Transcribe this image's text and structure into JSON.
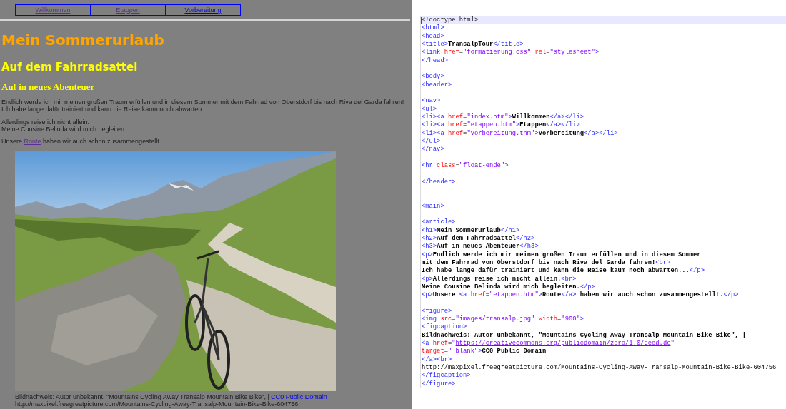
{
  "browser_page": {
    "nav": [
      {
        "label": "Willkommen",
        "visited": true
      },
      {
        "label": "Etappen",
        "visited": true
      },
      {
        "label": "Vorbereitung",
        "visited": false
      }
    ],
    "h1": "Mein Sommerurlaub",
    "h2": "Auf dem Fahrradsattel",
    "h3": "Auf in neues Abenteuer",
    "paragraphs": [
      {
        "kind": "text",
        "lines": [
          "Endlich werde ich mir meinen großen Traum erfüllen und in diesem Sommer mit dem Fahrrad von Oberstdorf bis nach Riva del Garda fahren!",
          "Ich habe lange dafür trainiert und kann die Reise kaum noch abwarten..."
        ]
      },
      {
        "kind": "text",
        "lines": [
          "Allerdings reise ich nicht allein.",
          "Meine Cousine Belinda wird mich begleiten."
        ]
      },
      {
        "kind": "link",
        "before": "Unsere ",
        "link": {
          "label": "Route",
          "visited": true
        },
        "after": " haben wir auch schon zusammengestellt."
      }
    ],
    "figure": {
      "caption_text": "Bildnachweis: Autor unbekannt, \"Mountains Cycling Away Transalp Mountain Bike Bike\", | ",
      "caption_link": {
        "label": "CC0 Public Domain",
        "visited": false
      },
      "caption_source": "http://maxpixel.freegreatpicture.com/Mountains-Cycling-Away-Transalp-Mountain-Bike-Bike-604756"
    }
  },
  "editor": {
    "lines": [
      {
        "current": true,
        "tokens": [
          {
            "kind": "doctype",
            "text": "<!doctype html>"
          }
        ]
      },
      {
        "current": false,
        "tokens": [
          {
            "kind": "tag",
            "text": "<html>"
          }
        ]
      },
      {
        "current": false,
        "tokens": [
          {
            "kind": "tag",
            "text": "<head>"
          }
        ]
      },
      {
        "current": false,
        "tokens": [
          {
            "kind": "tag",
            "text": "<title>"
          },
          {
            "kind": "text",
            "text": "TransalpTour"
          },
          {
            "kind": "tag",
            "text": "</title>"
          }
        ]
      },
      {
        "current": false,
        "tokens": [
          {
            "kind": "tag",
            "text": "<link"
          },
          {
            "kind": "attr",
            "text": " href"
          },
          {
            "kind": "punct",
            "text": "="
          },
          {
            "kind": "value",
            "text": "\"formatierung.css\""
          },
          {
            "kind": "attr",
            "text": " rel"
          },
          {
            "kind": "punct",
            "text": "="
          },
          {
            "kind": "value",
            "text": "\"stylesheet\""
          },
          {
            "kind": "tag",
            "text": ">"
          }
        ]
      },
      {
        "current": false,
        "tokens": [
          {
            "kind": "tag",
            "text": "</head>"
          }
        ]
      },
      {
        "current": false
      },
      {
        "current": false,
        "tokens": [
          {
            "kind": "tag",
            "text": "<body>"
          }
        ]
      },
      {
        "current": false,
        "tokens": [
          {
            "kind": "tag",
            "text": "<header>"
          }
        ]
      },
      {
        "current": false
      },
      {
        "current": false,
        "tokens": [
          {
            "kind": "tag",
            "text": "<nav>"
          }
        ]
      },
      {
        "current": false,
        "tokens": [
          {
            "kind": "tag",
            "text": "<ul>"
          }
        ]
      },
      {
        "current": false,
        "tokens": [
          {
            "kind": "tag",
            "text": "<li><a"
          },
          {
            "kind": "attr",
            "text": " href"
          },
          {
            "kind": "punct",
            "text": "="
          },
          {
            "kind": "value",
            "text": "\"index.htm\""
          },
          {
            "kind": "tag",
            "text": ">"
          },
          {
            "kind": "text",
            "text": "Willkommen"
          },
          {
            "kind": "tag",
            "text": "</a></li>"
          }
        ]
      },
      {
        "current": false,
        "tokens": [
          {
            "kind": "tag",
            "text": "<li><a"
          },
          {
            "kind": "attr",
            "text": " href"
          },
          {
            "kind": "punct",
            "text": "="
          },
          {
            "kind": "value",
            "text": "\"etappen.htm\""
          },
          {
            "kind": "tag",
            "text": ">"
          },
          {
            "kind": "text",
            "text": "Etappen"
          },
          {
            "kind": "tag",
            "text": "</a></li>"
          }
        ]
      },
      {
        "current": false,
        "tokens": [
          {
            "kind": "tag",
            "text": "<li><a"
          },
          {
            "kind": "attr",
            "text": " href"
          },
          {
            "kind": "punct",
            "text": "="
          },
          {
            "kind": "value",
            "text": "\"vorbereitung.thm\""
          },
          {
            "kind": "tag",
            "text": ">"
          },
          {
            "kind": "text",
            "text": "Vorbereitung"
          },
          {
            "kind": "tag",
            "text": "</a></li>"
          }
        ]
      },
      {
        "current": false,
        "tokens": [
          {
            "kind": "tag",
            "text": "</ul>"
          }
        ]
      },
      {
        "current": false,
        "tokens": [
          {
            "kind": "tag",
            "text": "</nav>"
          }
        ]
      },
      {
        "current": false
      },
      {
        "current": false,
        "tokens": [
          {
            "kind": "tag",
            "text": "<hr"
          },
          {
            "kind": "attr",
            "text": " class"
          },
          {
            "kind": "punct",
            "text": "="
          },
          {
            "kind": "value",
            "text": "\"float-ende\""
          },
          {
            "kind": "tag",
            "text": ">"
          }
        ]
      },
      {
        "current": false
      },
      {
        "current": false,
        "tokens": [
          {
            "kind": "tag",
            "text": "</header>"
          }
        ]
      },
      {
        "current": false
      },
      {
        "current": false
      },
      {
        "current": false,
        "tokens": [
          {
            "kind": "tag",
            "text": "<main>"
          }
        ]
      },
      {
        "current": false
      },
      {
        "current": false,
        "tokens": [
          {
            "kind": "tag",
            "text": "<article>"
          }
        ]
      },
      {
        "current": false,
        "tokens": [
          {
            "kind": "tag",
            "text": "<h1>"
          },
          {
            "kind": "text",
            "text": "Mein Sommerurlaub"
          },
          {
            "kind": "tag",
            "text": "</h1>"
          }
        ]
      },
      {
        "current": false,
        "tokens": [
          {
            "kind": "tag",
            "text": "<h2>"
          },
          {
            "kind": "text",
            "text": "Auf dem Fahrradsattel"
          },
          {
            "kind": "tag",
            "text": "</h2>"
          }
        ]
      },
      {
        "current": false,
        "tokens": [
          {
            "kind": "tag",
            "text": "<h3>"
          },
          {
            "kind": "text",
            "text": "Auf in neues Abenteuer"
          },
          {
            "kind": "tag",
            "text": "</h3>"
          }
        ]
      },
      {
        "current": false,
        "tokens": [
          {
            "kind": "tag",
            "text": "<p>"
          },
          {
            "kind": "text",
            "text": "Endlich werde ich mir meinen großen Traum erfüllen und in diesem Sommer"
          }
        ]
      },
      {
        "current": false,
        "tokens": [
          {
            "kind": "text",
            "text": "mit dem Fahrrad von Oberstdorf bis nach Riva del Garda fahren!"
          },
          {
            "kind": "tag",
            "text": "<br>"
          }
        ]
      },
      {
        "current": false,
        "tokens": [
          {
            "kind": "text",
            "text": "Ich habe lange dafür trainiert und kann die Reise kaum noch abwarten..."
          },
          {
            "kind": "tag",
            "text": "</p>"
          }
        ]
      },
      {
        "current": false,
        "tokens": [
          {
            "kind": "tag",
            "text": "<p>"
          },
          {
            "kind": "text",
            "text": "Allerdings reise ich nicht allein."
          },
          {
            "kind": "tag",
            "text": "<br>"
          }
        ]
      },
      {
        "current": false,
        "tokens": [
          {
            "kind": "text",
            "text": "Meine Cousine Belinda wird mich begleiten."
          },
          {
            "kind": "tag",
            "text": "</p>"
          }
        ]
      },
      {
        "current": false,
        "tokens": [
          {
            "kind": "tag",
            "text": "<p>"
          },
          {
            "kind": "text",
            "text": "Unsere "
          },
          {
            "kind": "tag",
            "text": "<a"
          },
          {
            "kind": "attr",
            "text": " href"
          },
          {
            "kind": "punct",
            "text": "="
          },
          {
            "kind": "value",
            "text": "\"etappen.htm\""
          },
          {
            "kind": "tag",
            "text": ">"
          },
          {
            "kind": "text",
            "text": "Route"
          },
          {
            "kind": "tag",
            "text": "</a>"
          },
          {
            "kind": "text",
            "text": " haben wir auch schon zusammengestellt."
          },
          {
            "kind": "tag",
            "text": "</p>"
          }
        ]
      },
      {
        "current": false
      },
      {
        "current": false,
        "tokens": [
          {
            "kind": "tag",
            "text": "<figure>"
          }
        ]
      },
      {
        "current": false,
        "tokens": [
          {
            "kind": "tag",
            "text": "<img"
          },
          {
            "kind": "attr",
            "text": " src"
          },
          {
            "kind": "punct",
            "text": "="
          },
          {
            "kind": "value",
            "text": "\"images/transalp.jpg\""
          },
          {
            "kind": "attr",
            "text": " width"
          },
          {
            "kind": "punct",
            "text": "="
          },
          {
            "kind": "value",
            "text": "\"900\""
          },
          {
            "kind": "tag",
            "text": ">"
          }
        ]
      },
      {
        "current": false,
        "tokens": [
          {
            "kind": "tag",
            "text": "<figcaption>"
          }
        ]
      },
      {
        "current": false,
        "tokens": [
          {
            "kind": "text",
            "text": "Bildnachweis: Autor unbekannt, \"Mountains Cycling Away Transalp Mountain Bike Bike\", |"
          }
        ]
      },
      {
        "current": false,
        "tokens": [
          {
            "kind": "tag",
            "text": "<a"
          },
          {
            "kind": "attr",
            "text": " href"
          },
          {
            "kind": "punct",
            "text": "="
          },
          {
            "kind": "value",
            "text": "\""
          },
          {
            "kind": "value-link",
            "text": "https://creativecommons.org/publicdomain/zero/1.0/deed.de"
          },
          {
            "kind": "value",
            "text": "\""
          }
        ]
      },
      {
        "current": false,
        "tokens": [
          {
            "kind": "attr",
            "text": "target"
          },
          {
            "kind": "punct",
            "text": "="
          },
          {
            "kind": "value",
            "text": "\"_blank\""
          },
          {
            "kind": "tag",
            "text": ">"
          },
          {
            "kind": "text",
            "text": "CC0 Public Domain"
          }
        ]
      },
      {
        "current": false,
        "tokens": [
          {
            "kind": "tag",
            "text": "</a><br>"
          }
        ]
      },
      {
        "current": false,
        "tokens": [
          {
            "kind": "text-link",
            "text": "http://maxpixel.freegreatpicture.com/Mountains-Cycling-Away-Transalp-Mountain-Bike-Bike-604756"
          }
        ]
      },
      {
        "current": false,
        "tokens": [
          {
            "kind": "tag",
            "text": "</figcaption>"
          }
        ]
      },
      {
        "current": false,
        "tokens": [
          {
            "kind": "tag",
            "text": "</figure>"
          }
        ]
      }
    ]
  }
}
